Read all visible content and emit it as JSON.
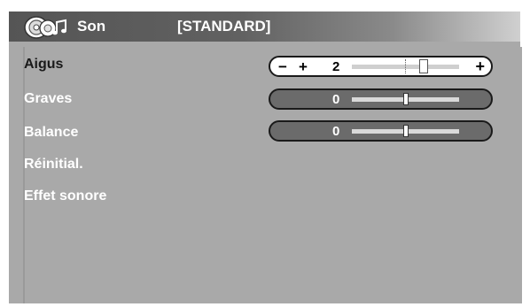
{
  "header": {
    "title": "Son",
    "mode": "[STANDARD]",
    "icon": "speaker-music-icon"
  },
  "menu": [
    {
      "label": "Aigus",
      "selected": true,
      "value": "2",
      "slider": true,
      "level": 0.667
    },
    {
      "label": "Graves",
      "selected": false,
      "value": "0",
      "slider": true,
      "level": 0.5
    },
    {
      "label": "Balance",
      "selected": false,
      "value": "0",
      "slider": true,
      "level": 0.5
    },
    {
      "label": "Réinitial.",
      "selected": false
    },
    {
      "label": "Effet sonore",
      "selected": false
    }
  ],
  "symbols": {
    "minus": "−",
    "plus": "+"
  },
  "colors": {
    "header_dark": "#555555",
    "panel": "#a9a9a9",
    "selected_text": "#1a1a1a",
    "item_text": "#ffffff",
    "slider_inactive": "#6b6b6b"
  }
}
